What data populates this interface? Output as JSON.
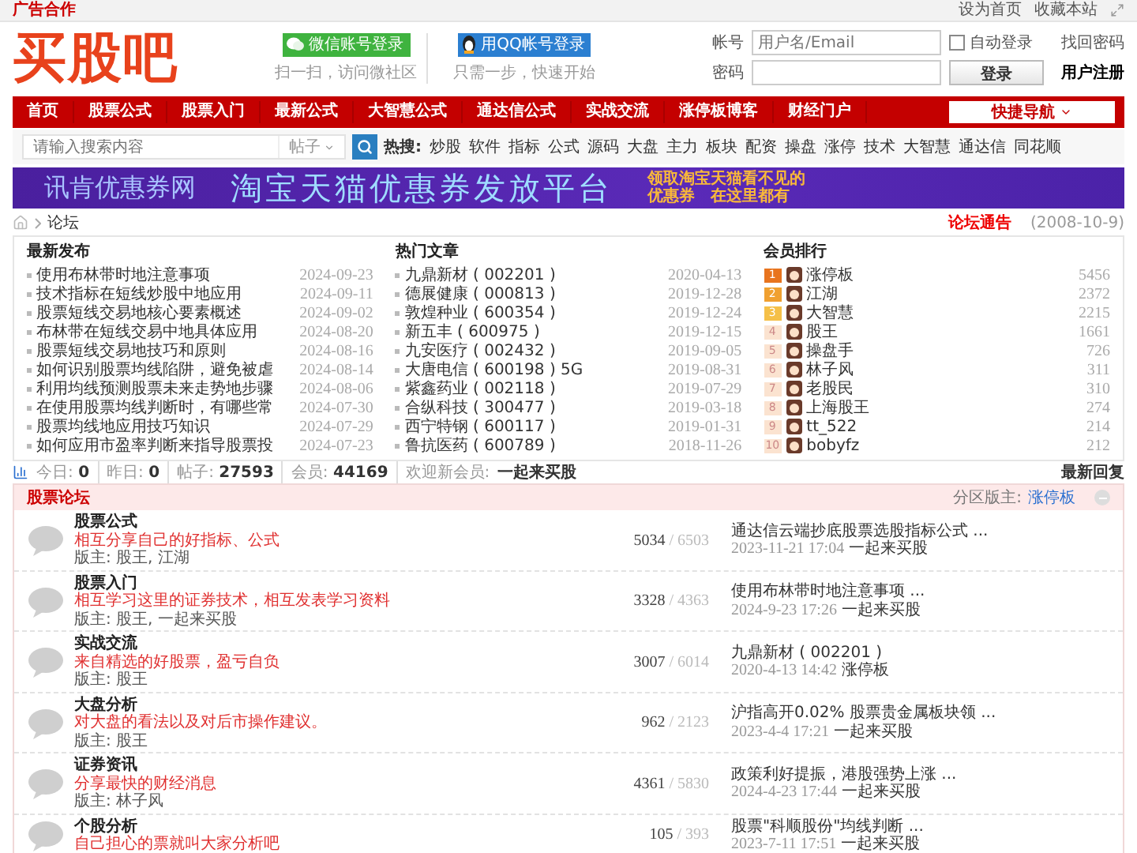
{
  "top_bar": {
    "ad_link": "广告合作",
    "links": [
      "设为首页",
      "收藏本站"
    ]
  },
  "header": {
    "logo": "买股吧",
    "wechat_login": {
      "button": "微信账号登录",
      "caption": "扫一扫，访问微社区"
    },
    "qq_login": {
      "button": "用QQ帐号登录",
      "caption": "只需一步，快速开始"
    },
    "login_form": {
      "username_label": "帐号",
      "username_placeholder": "用户名/Email",
      "password_label": "密码",
      "auto_login": {
        "label": "自动登录",
        "checked": false
      },
      "submit": "登录",
      "forgot": "找回密码",
      "register": "用户注册"
    }
  },
  "nav": {
    "items": [
      "首页",
      "股票公式",
      "股票入门",
      "最新公式",
      "大智慧公式",
      "通达信公式",
      "实战交流",
      "涨停板博客",
      "财经门户"
    ],
    "quick_nav": "快捷导航"
  },
  "search": {
    "placeholder": "请输入搜索内容",
    "scope": "帖子",
    "hot_label": "热搜:",
    "hot_terms": [
      "炒股",
      "软件",
      "指标",
      "公式",
      "源码",
      "大盘",
      "主力",
      "板块",
      "配资",
      "操盘",
      "涨停",
      "技术",
      "大智慧",
      "通达信",
      "同花顺"
    ]
  },
  "banner": {
    "site": "讯肯优惠券网",
    "headline": "淘宝天猫优惠券发放平台",
    "tagline": [
      "领取淘宝天猫看不见的",
      "优惠券　在这里都有"
    ]
  },
  "breadcrumb": {
    "current": "论坛",
    "announcement": "论坛通告",
    "announcement_date": "(2008-10-9)"
  },
  "latest": {
    "title": "最新发布",
    "items": [
      {
        "title": "使用布林带时地注意事项",
        "date": "2024-09-23"
      },
      {
        "title": "技术指标在短线炒股中地应用",
        "date": "2024-09-11"
      },
      {
        "title": "股票短线交易地核心要素概述",
        "date": "2024-09-02"
      },
      {
        "title": "布林带在短线交易中地具体应用",
        "date": "2024-08-20"
      },
      {
        "title": "股票短线交易地技巧和原则",
        "date": "2024-08-16"
      },
      {
        "title": "如何识别股票均线陷阱，避免被虐",
        "date": "2024-08-14"
      },
      {
        "title": "利用均线预测股票未来走势地步骤",
        "date": "2024-08-06"
      },
      {
        "title": "在使用股票均线判断时，有哪些常",
        "date": "2024-07-30"
      },
      {
        "title": "股票均线地应用技巧知识",
        "date": "2024-07-29"
      },
      {
        "title": "如何应用市盈率判断来指导股票投",
        "date": "2024-07-23"
      }
    ]
  },
  "hot": {
    "title": "热门文章",
    "items": [
      {
        "title": "九鼎新材 ( 002201 )",
        "date": "2020-04-13"
      },
      {
        "title": "德展健康 ( 000813 )",
        "date": "2019-12-28"
      },
      {
        "title": "敦煌种业 ( 600354 )",
        "date": "2019-12-24"
      },
      {
        "title": "新五丰 ( 600975 )",
        "date": "2019-12-15"
      },
      {
        "title": "九安医疗 ( 002432 )",
        "date": "2019-09-05"
      },
      {
        "title": "大唐电信 ( 600198 ) 5G",
        "date": "2019-08-31"
      },
      {
        "title": "紫鑫药业 ( 002118 )",
        "date": "2019-07-29"
      },
      {
        "title": "合纵科技 ( 300477 )",
        "date": "2019-03-18"
      },
      {
        "title": "西宁特钢 ( 600117 )",
        "date": "2019-01-31"
      },
      {
        "title": "鲁抗医药 ( 600789 )",
        "date": "2018-11-26"
      }
    ]
  },
  "ranking": {
    "title": "会员排行",
    "items": [
      {
        "rank": "1",
        "name": "涨停板",
        "score": "5456",
        "color": "#e8741e"
      },
      {
        "rank": "2",
        "name": "江湖",
        "score": "2372",
        "color": "#f0a030"
      },
      {
        "rank": "3",
        "name": "大智慧",
        "score": "2215",
        "color": "#f5c048"
      },
      {
        "rank": "4",
        "name": "股王",
        "score": "1661",
        "color": "#fbe3d0"
      },
      {
        "rank": "5",
        "name": "操盘手",
        "score": "726",
        "color": "#fbe3d0"
      },
      {
        "rank": "6",
        "name": "林子风",
        "score": "311",
        "color": "#fbe3d0"
      },
      {
        "rank": "7",
        "name": "老股民",
        "score": "310",
        "color": "#fbe3d0"
      },
      {
        "rank": "8",
        "name": "上海股王",
        "score": "274",
        "color": "#fbe3d0"
      },
      {
        "rank": "9",
        "name": "tt_522",
        "score": "214",
        "color": "#fbe3d0"
      },
      {
        "rank": "10",
        "name": "bobyfz",
        "score": "212",
        "color": "#fbe3d0"
      }
    ]
  },
  "stats": {
    "items": [
      {
        "label": "今日:",
        "value": "0"
      },
      {
        "label": "昨日:",
        "value": "0"
      },
      {
        "label": "帖子:",
        "value": "27593"
      },
      {
        "label": "会员:",
        "value": "44169"
      }
    ],
    "welcome_label": "欢迎新会员:",
    "newest_member": "一起来买股",
    "latest_replies": "最新回复"
  },
  "forum": {
    "count_separator": "/",
    "title": "股票论坛",
    "moderator_label": "分区版主:",
    "moderator": "涨停板",
    "boards": [
      {
        "name": "股票公式",
        "description": "相互分享自己的好指标、公式",
        "moderators": "版主: 股王, 江湖",
        "topics": "5034",
        "posts": "6503",
        "last_title": "通达信云端抄底股票选股指标公式 ...",
        "last_time": "2023-11-21 17:04",
        "last_user": "一起来买股"
      },
      {
        "name": "股票入门",
        "description": "相互学习这里的证券技术，相互发表学习资料",
        "moderators": "版主: 股王, 一起来买股",
        "topics": "3328",
        "posts": "4363",
        "last_title": "使用布林带时地注意事项 ...",
        "last_time": "2024-9-23 17:26",
        "last_user": "一起来买股"
      },
      {
        "name": "实战交流",
        "description": "来自精选的好股票，盈亏自负",
        "moderators": "版主: 股王",
        "topics": "3007",
        "posts": "6014",
        "last_title": "九鼎新材 ( 002201 )",
        "last_time": "2020-4-13 14:42",
        "last_user": "涨停板"
      },
      {
        "name": "大盘分析",
        "description": "对大盘的看法以及对后市操作建议。",
        "moderators": "版主: 股王",
        "topics": "962",
        "posts": "2123",
        "last_title": "沪指高开0.02% 股票贵金属板块领 ...",
        "last_time": "2023-4-4 17:21",
        "last_user": "一起来买股"
      },
      {
        "name": "证券资讯",
        "description": "分享最快的财经消息",
        "moderators": "版主: 林子风",
        "topics": "4361",
        "posts": "5830",
        "last_title": "政策利好提振，港股强势上涨 ...",
        "last_time": "2024-4-23 17:44",
        "last_user": "一起来买股"
      },
      {
        "name": "个股分析",
        "description": "自己担心的票就叫大家分析吧",
        "topics": "105",
        "posts": "393",
        "last_title": "股票\"科顺股份\"均线判断 ...",
        "last_time": "2023-7-11 17:51",
        "last_user": "一起来买股"
      }
    ]
  }
}
